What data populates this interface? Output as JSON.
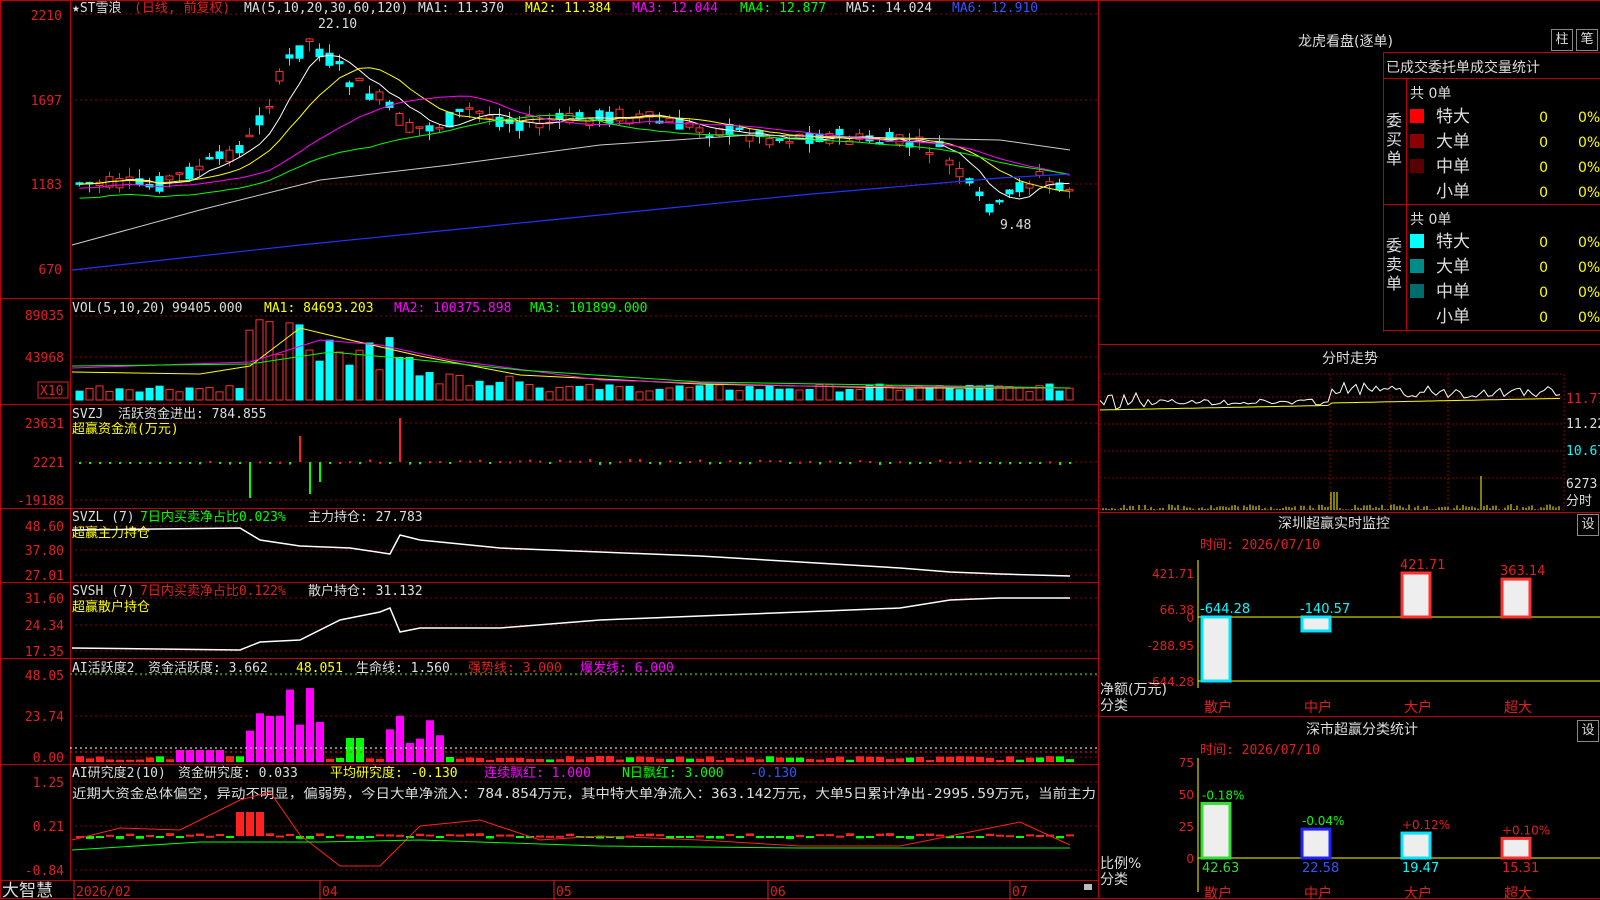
{
  "stock": {
    "name": "★ST雪浪",
    "mode": "(日线, 前复权)",
    "ma_label": "MA(5,10,20,30,60,120)",
    "ma1": "MA1: 11.370",
    "ma2": "MA2: 11.384",
    "ma3": "MA3: 12.044",
    "ma4": "MA4: 12.877",
    "ma5": "MA5: 14.024",
    "ma6": "MA6: 12.910",
    "high_mark": "22.10",
    "low_mark": "9.48",
    "y_ticks": [
      "2210",
      "1697",
      "1183",
      "670"
    ]
  },
  "vol": {
    "label": "VOL(5,10,20)",
    "value": "99405.000",
    "ma1": "MA1: 84693.203",
    "ma2": "MA2: 100375.898",
    "ma3": "MA3: 101899.000",
    "unit": "X10",
    "y_ticks": [
      "89035",
      "43968"
    ]
  },
  "svzj": {
    "label": "SVZJ",
    "text": "活跃资金进出: 784.855",
    "sub": "超赢资金流(万元)",
    "y_ticks": [
      "23631",
      "2221",
      "-19188"
    ]
  },
  "svzl": {
    "label": "SVZL (7)",
    "text1": "7日内买卖净占比0.023%",
    "text2": "主力持仓: 27.783",
    "sub": "超赢主力持仓",
    "y_ticks": [
      "48.60",
      "37.80",
      "27.01"
    ]
  },
  "svsh": {
    "label": "SVSH (7)",
    "text1": "7日内买卖净占比0.122%",
    "text2": "散户持仓: 31.132",
    "sub": "超赢散户持仓",
    "y_ticks": [
      "31.60",
      "24.34",
      "17.35"
    ]
  },
  "ai2": {
    "label": "AI活跃度2",
    "t1": "资金活跃度: 3.662",
    "t2": "48.051",
    "t3": "生命线: 1.560",
    "t4": "强势线: 3.000",
    "t5": "爆发线: 6.000",
    "y_ticks": [
      "48.05",
      "23.74",
      "0.00"
    ]
  },
  "ai_research": {
    "label": "AI研究度2(10)",
    "t1": "资金研究度: 0.033",
    "t2": "平均研究度: -0.130",
    "t3": "连续飘红: 1.000",
    "t4": "N日飘红: 3.000",
    "t5": "-0.130",
    "comment": "近期大资金总体偏空，异动不明显，偏弱势，今日大单净流入：784.854万元，其中特大单净流入：363.142万元，大单5日累计净出-2995.59万元，当前主力",
    "y_ticks": [
      "1.25",
      "0.21",
      "-0.84"
    ]
  },
  "x_axis": [
    "2026/02",
    "04",
    "05",
    "06",
    "07"
  ],
  "logo": "大智慧",
  "lhb": {
    "title": "龙虎看盘(逐单)",
    "btn1": "柱",
    "btn2": "笔",
    "header": "已成交委托单成交量统计",
    "buy_side": "委买单",
    "sell_side": "委卖单",
    "buy_total": "共 0单",
    "sell_total": "共 0单",
    "buy_rows": [
      {
        "label": "特大",
        "count": "0",
        "pct": "0%",
        "color": "#ff0000"
      },
      {
        "label": "大单",
        "count": "0",
        "pct": "0%",
        "color": "#8b0000"
      },
      {
        "label": "中单",
        "count": "0",
        "pct": "0%",
        "color": "#5a0000"
      },
      {
        "label": "小单",
        "count": "0",
        "pct": "0%",
        "color": "#000000"
      }
    ],
    "sell_rows": [
      {
        "label": "特大",
        "count": "0",
        "pct": "0%",
        "color": "#00ffff"
      },
      {
        "label": "大单",
        "count": "0",
        "pct": "0%",
        "color": "#008b8b"
      },
      {
        "label": "中单",
        "count": "0",
        "pct": "0%",
        "color": "#006b6b"
      },
      {
        "label": "小单",
        "count": "0",
        "pct": "0%",
        "color": "#000000"
      }
    ]
  },
  "intraday": {
    "title": "分时走势",
    "p1": "11.77",
    "p2": "11.22",
    "p3": "10.67",
    "vol": "6273",
    "vol_label": "分时"
  },
  "monitor": {
    "title": "深圳超赢实时监控",
    "set": "设",
    "time": "时间: 2026/07/10",
    "y_ticks": [
      "421.71",
      "66.38",
      "0",
      "-288.95",
      "-644.28"
    ],
    "y_title": "净额(万元)",
    "x_title": "分类",
    "bars": [
      {
        "cat": "散户",
        "value": -644.28,
        "label": "-644.28",
        "color": "#00e5ff"
      },
      {
        "cat": "中户",
        "value": -140.57,
        "label": "-140.57",
        "color": "#00e5ff"
      },
      {
        "cat": "大户",
        "value": 421.71,
        "label": "421.71",
        "color": "#ff3030"
      },
      {
        "cat": "超大",
        "value": 363.14,
        "label": "363.14",
        "color": "#ff3030"
      }
    ]
  },
  "classify": {
    "title": "深市超赢分类统计",
    "set": "设",
    "time": "时间: 2026/07/10",
    "y_ticks": [
      "75",
      "50",
      "25",
      "0"
    ],
    "y_title": "比例%",
    "x_title": "分类",
    "bars": [
      {
        "cat": "散户",
        "value": 42.63,
        "label": "42.63",
        "delta": "-0.18%",
        "color": "#33dd33"
      },
      {
        "cat": "中户",
        "value": 22.58,
        "label": "22.58",
        "delta": "-0.04%",
        "color": "#2222ff"
      },
      {
        "cat": "大户",
        "value": 19.47,
        "label": "19.47",
        "delta": "+0.12%",
        "color": "#00e5ff"
      },
      {
        "cat": "超大",
        "value": 15.31,
        "label": "15.31",
        "delta": "+0.10%",
        "color": "#ff3030"
      }
    ]
  }
}
